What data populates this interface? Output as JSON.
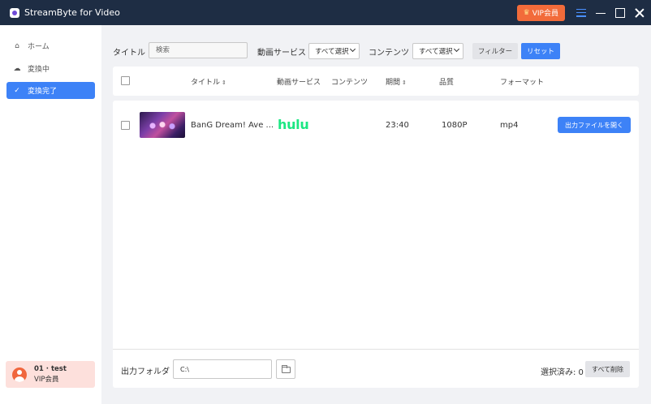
{
  "app": {
    "title": "StreamByte for Video",
    "accent_color": "#3d82f7",
    "vip_color": "#f26b3a"
  },
  "titlebar": {
    "vip_label": "VIP会員"
  },
  "sidebar": {
    "items": [
      {
        "label": "ホーム",
        "icon": "home-icon"
      },
      {
        "label": "変換中",
        "icon": "cloud-download-icon"
      },
      {
        "label": "変換完了",
        "icon": "check-circle-icon",
        "active": true
      }
    ],
    "user": {
      "name": "01 · test",
      "plan": "VIP会員"
    }
  },
  "filters": {
    "title_label": "タイトル",
    "search_placeholder": "検索",
    "service_label": "動画サービス",
    "service_value": "すべて選択",
    "content_label": "コンテンツ",
    "content_value": "すべて選択",
    "filter_button": "フィルター",
    "reset_button": "リセット"
  },
  "table": {
    "columns": {
      "title": "タイトル",
      "service": "動画サービス",
      "content": "コンテンツ",
      "duration": "期間",
      "quality": "品質",
      "format": "フォーマット"
    },
    "rows": [
      {
        "title": "BanG Dream! Ave ...",
        "service": "hulu",
        "duration": "23:40",
        "quality": "1080P",
        "format": "mp4",
        "action": "出力ファイルを開く"
      }
    ]
  },
  "footer": {
    "folder_label": "出力フォルダ",
    "folder_path": "C:\\",
    "selected_text": "選択済み: 0",
    "delete_all_button": "すべて削除"
  }
}
